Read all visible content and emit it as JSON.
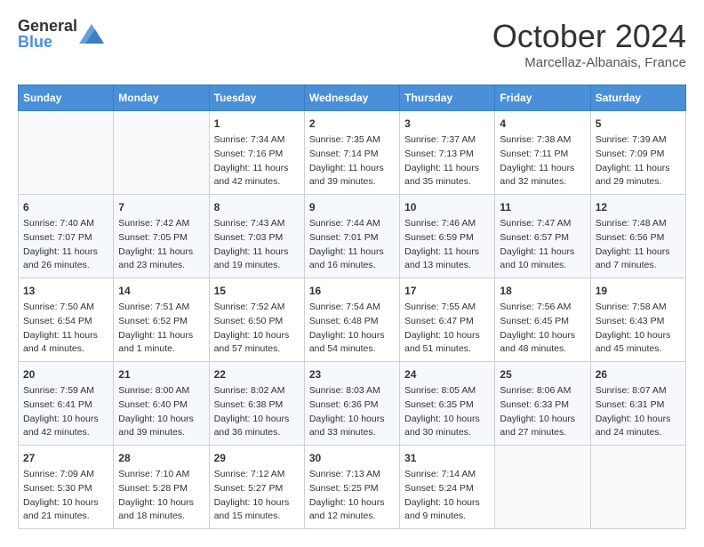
{
  "header": {
    "logo_general": "General",
    "logo_blue": "Blue",
    "month_title": "October 2024",
    "subtitle": "Marcellaz-Albanais, France"
  },
  "days_of_week": [
    "Sunday",
    "Monday",
    "Tuesday",
    "Wednesday",
    "Thursday",
    "Friday",
    "Saturday"
  ],
  "weeks": [
    [
      {
        "day": "",
        "info": ""
      },
      {
        "day": "",
        "info": ""
      },
      {
        "day": "1",
        "info": "Sunrise: 7:34 AM\nSunset: 7:16 PM\nDaylight: 11 hours and 42 minutes."
      },
      {
        "day": "2",
        "info": "Sunrise: 7:35 AM\nSunset: 7:14 PM\nDaylight: 11 hours and 39 minutes."
      },
      {
        "day": "3",
        "info": "Sunrise: 7:37 AM\nSunset: 7:13 PM\nDaylight: 11 hours and 35 minutes."
      },
      {
        "day": "4",
        "info": "Sunrise: 7:38 AM\nSunset: 7:11 PM\nDaylight: 11 hours and 32 minutes."
      },
      {
        "day": "5",
        "info": "Sunrise: 7:39 AM\nSunset: 7:09 PM\nDaylight: 11 hours and 29 minutes."
      }
    ],
    [
      {
        "day": "6",
        "info": "Sunrise: 7:40 AM\nSunset: 7:07 PM\nDaylight: 11 hours and 26 minutes."
      },
      {
        "day": "7",
        "info": "Sunrise: 7:42 AM\nSunset: 7:05 PM\nDaylight: 11 hours and 23 minutes."
      },
      {
        "day": "8",
        "info": "Sunrise: 7:43 AM\nSunset: 7:03 PM\nDaylight: 11 hours and 19 minutes."
      },
      {
        "day": "9",
        "info": "Sunrise: 7:44 AM\nSunset: 7:01 PM\nDaylight: 11 hours and 16 minutes."
      },
      {
        "day": "10",
        "info": "Sunrise: 7:46 AM\nSunset: 6:59 PM\nDaylight: 11 hours and 13 minutes."
      },
      {
        "day": "11",
        "info": "Sunrise: 7:47 AM\nSunset: 6:57 PM\nDaylight: 11 hours and 10 minutes."
      },
      {
        "day": "12",
        "info": "Sunrise: 7:48 AM\nSunset: 6:56 PM\nDaylight: 11 hours and 7 minutes."
      }
    ],
    [
      {
        "day": "13",
        "info": "Sunrise: 7:50 AM\nSunset: 6:54 PM\nDaylight: 11 hours and 4 minutes."
      },
      {
        "day": "14",
        "info": "Sunrise: 7:51 AM\nSunset: 6:52 PM\nDaylight: 11 hours and 1 minute."
      },
      {
        "day": "15",
        "info": "Sunrise: 7:52 AM\nSunset: 6:50 PM\nDaylight: 10 hours and 57 minutes."
      },
      {
        "day": "16",
        "info": "Sunrise: 7:54 AM\nSunset: 6:48 PM\nDaylight: 10 hours and 54 minutes."
      },
      {
        "day": "17",
        "info": "Sunrise: 7:55 AM\nSunset: 6:47 PM\nDaylight: 10 hours and 51 minutes."
      },
      {
        "day": "18",
        "info": "Sunrise: 7:56 AM\nSunset: 6:45 PM\nDaylight: 10 hours and 48 minutes."
      },
      {
        "day": "19",
        "info": "Sunrise: 7:58 AM\nSunset: 6:43 PM\nDaylight: 10 hours and 45 minutes."
      }
    ],
    [
      {
        "day": "20",
        "info": "Sunrise: 7:59 AM\nSunset: 6:41 PM\nDaylight: 10 hours and 42 minutes."
      },
      {
        "day": "21",
        "info": "Sunrise: 8:00 AM\nSunset: 6:40 PM\nDaylight: 10 hours and 39 minutes."
      },
      {
        "day": "22",
        "info": "Sunrise: 8:02 AM\nSunset: 6:38 PM\nDaylight: 10 hours and 36 minutes."
      },
      {
        "day": "23",
        "info": "Sunrise: 8:03 AM\nSunset: 6:36 PM\nDaylight: 10 hours and 33 minutes."
      },
      {
        "day": "24",
        "info": "Sunrise: 8:05 AM\nSunset: 6:35 PM\nDaylight: 10 hours and 30 minutes."
      },
      {
        "day": "25",
        "info": "Sunrise: 8:06 AM\nSunset: 6:33 PM\nDaylight: 10 hours and 27 minutes."
      },
      {
        "day": "26",
        "info": "Sunrise: 8:07 AM\nSunset: 6:31 PM\nDaylight: 10 hours and 24 minutes."
      }
    ],
    [
      {
        "day": "27",
        "info": "Sunrise: 7:09 AM\nSunset: 5:30 PM\nDaylight: 10 hours and 21 minutes."
      },
      {
        "day": "28",
        "info": "Sunrise: 7:10 AM\nSunset: 5:28 PM\nDaylight: 10 hours and 18 minutes."
      },
      {
        "day": "29",
        "info": "Sunrise: 7:12 AM\nSunset: 5:27 PM\nDaylight: 10 hours and 15 minutes."
      },
      {
        "day": "30",
        "info": "Sunrise: 7:13 AM\nSunset: 5:25 PM\nDaylight: 10 hours and 12 minutes."
      },
      {
        "day": "31",
        "info": "Sunrise: 7:14 AM\nSunset: 5:24 PM\nDaylight: 10 hours and 9 minutes."
      },
      {
        "day": "",
        "info": ""
      },
      {
        "day": "",
        "info": ""
      }
    ]
  ]
}
